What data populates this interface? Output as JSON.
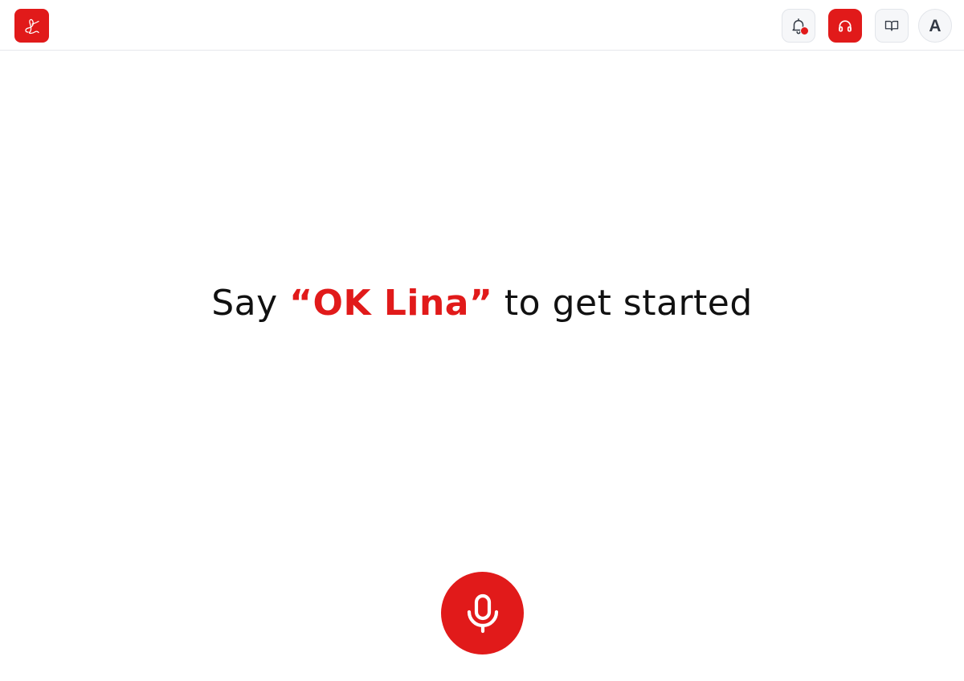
{
  "header": {
    "logo_icon": "handwritten-l-logo",
    "buttons": [
      {
        "icon": "bell-icon",
        "has_notification": true
      },
      {
        "icon": "headphones-icon",
        "active": true
      },
      {
        "icon": "book-open-icon"
      },
      {
        "icon": "account-avatar",
        "label": "A"
      }
    ]
  },
  "main": {
    "prompt_prefix": "Say ",
    "wake_phrase": "“OK Lina”",
    "prompt_suffix": " to get started"
  },
  "mic": {
    "icon": "microphone-icon"
  },
  "colors": {
    "accent": "#e11a1a",
    "text": "#111111",
    "border": "#e6e8ec",
    "button_bg": "#f6f7f9"
  }
}
